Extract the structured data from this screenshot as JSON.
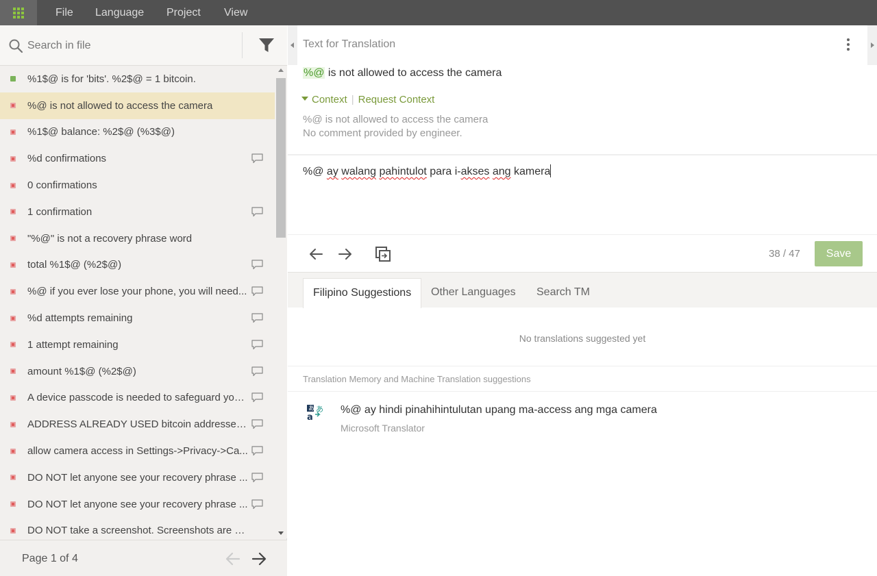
{
  "menu": {
    "app_icon": "grid-icon",
    "items": [
      "File",
      "Language",
      "Project",
      "View"
    ]
  },
  "search": {
    "placeholder": "Search in file",
    "icon": "search-icon",
    "filter_icon": "filter-icon"
  },
  "strings": [
    {
      "text": "%1$@ is for 'bits'. %2$@ = 1 bitcoin.",
      "status": "translated",
      "comment": false
    },
    {
      "text": "%@ is not allowed to access the camera",
      "status": "untranslated",
      "comment": false,
      "selected": true
    },
    {
      "text": "%1$@ balance: %2$@ (%3$@)",
      "status": "untranslated",
      "comment": false
    },
    {
      "text": "%d confirmations",
      "status": "untranslated",
      "comment": true
    },
    {
      "text": "0 confirmations",
      "status": "untranslated",
      "comment": false
    },
    {
      "text": "1 confirmation",
      "status": "untranslated",
      "comment": true
    },
    {
      "text": "\"%@\" is not a recovery phrase word",
      "status": "untranslated",
      "comment": false
    },
    {
      "text": "total %1$@ (%2$@)",
      "status": "untranslated",
      "comment": true
    },
    {
      "text": "%@ if you ever lose your phone, you will need...",
      "status": "untranslated",
      "comment": true
    },
    {
      "text": "%d attempts remaining",
      "status": "untranslated",
      "comment": true
    },
    {
      "text": "1 attempt remaining",
      "status": "untranslated",
      "comment": true
    },
    {
      "text": "amount %1$@ (%2$@)",
      "status": "untranslated",
      "comment": true
    },
    {
      "text": "A device passcode is needed to safeguard you...",
      "status": "untranslated",
      "comment": true
    },
    {
      "text": "ADDRESS ALREADY USED bitcoin addresses ar...",
      "status": "untranslated",
      "comment": true
    },
    {
      "text": "allow camera access in Settings->Privacy->Ca...",
      "status": "untranslated",
      "comment": true
    },
    {
      "text": "DO NOT let anyone see your recovery phrase ...",
      "status": "untranslated",
      "comment": true
    },
    {
      "text": "DO NOT let anyone see your recovery phrase ...",
      "status": "untranslated",
      "comment": true
    },
    {
      "text": "DO NOT take a screenshot. Screenshots are visibl...",
      "status": "untranslated",
      "comment": false
    }
  ],
  "pager": {
    "label": "Page 1 of 4"
  },
  "editor": {
    "title": "Text for Translation",
    "source_placeholder": "%@",
    "source_rest": " is not allowed to access the camera",
    "context_link": "Context",
    "request_context_link": "Request Context",
    "context_text": "%@ is not allowed to access the camera",
    "context_comment": "No comment provided by engineer.",
    "translation_words": [
      {
        "w": "%@ ",
        "err": false
      },
      {
        "w": "ay",
        "err": true
      },
      {
        "w": " ",
        "err": false
      },
      {
        "w": "walang",
        "err": true
      },
      {
        "w": " ",
        "err": false
      },
      {
        "w": "pahintulot",
        "err": true
      },
      {
        "w": " para i-",
        "err": false
      },
      {
        "w": "akses",
        "err": true
      },
      {
        "w": " ",
        "err": false
      },
      {
        "w": "ang",
        "err": true
      },
      {
        "w": " kamera",
        "err": false
      }
    ],
    "char_count": "38 / 47",
    "save_label": "Save"
  },
  "suggestions": {
    "tabs": [
      "Filipino Suggestions",
      "Other Languages",
      "Search TM"
    ],
    "empty_text": "No translations suggested yet",
    "tm_header": "Translation Memory and Machine Translation suggestions",
    "mt_text": "%@ ay hindi pinahihintulutan upang ma-access ang mga camera",
    "mt_source": "Microsoft Translator"
  },
  "colors": {
    "topbar": "#515151",
    "accent_green": "#8dc63f",
    "save_button": "#a8c88a",
    "selected_row": "#f1e6c4",
    "untranslated_dot": "#e05c5c"
  }
}
